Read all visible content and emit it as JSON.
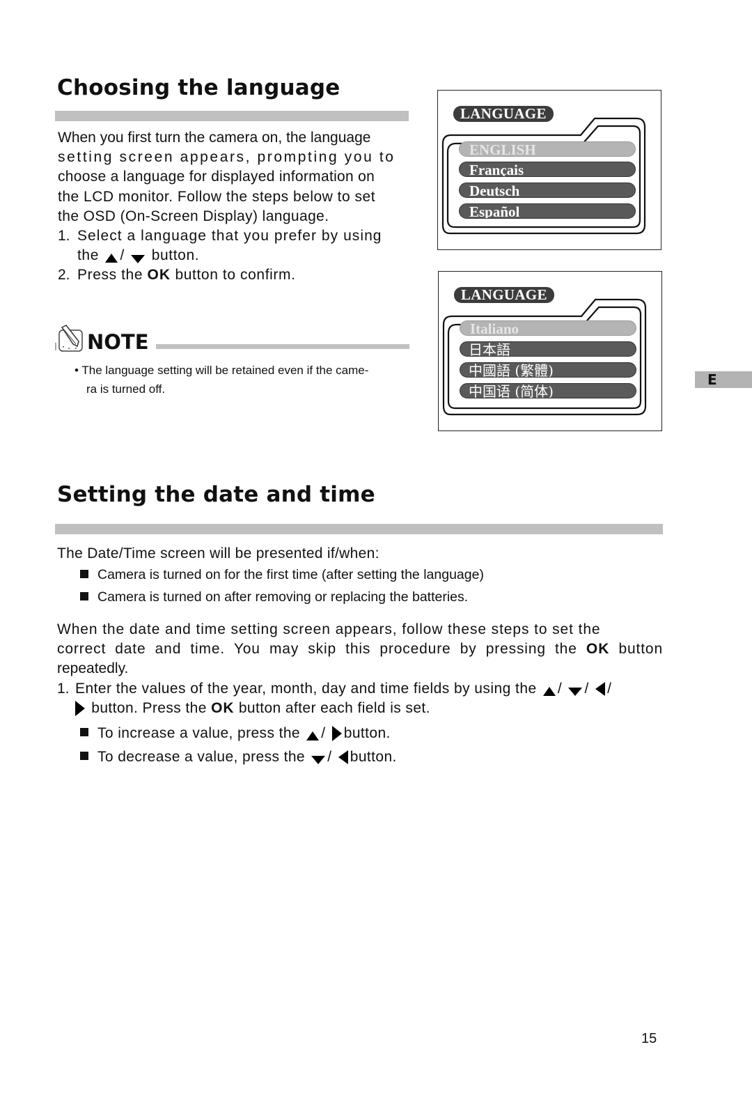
{
  "section1": {
    "title": "Choosing the language",
    "intro_lines": [
      "When you first turn the camera on, the language",
      "setting screen appears, prompting you to",
      "choose a language for displayed information on",
      "the LCD monitor. Follow the steps below to set",
      "the OSD (On-Screen Display) language."
    ],
    "steps": [
      {
        "num": "1.",
        "line1": "Select a language that you prefer by using",
        "line2_pre": "the",
        "sep": "/",
        "line2_post": "button."
      },
      {
        "num": "2.",
        "pre": "Press the",
        "ok": "OK",
        "post": "button to confirm."
      }
    ],
    "note": {
      "title": "NOTE",
      "bullet": "•",
      "line1": "The language setting will be retained even if the came-",
      "line2": "ra is turned off."
    }
  },
  "lcd_screens": [
    {
      "tab": "LANGUAGE",
      "items": [
        {
          "label": "ENGLISH",
          "selected": true
        },
        {
          "label": "Français",
          "selected": false
        },
        {
          "label": "Deutsch",
          "selected": false
        },
        {
          "label": "Español",
          "selected": false
        }
      ]
    },
    {
      "tab": "LANGUAGE",
      "items": [
        {
          "label": "Italiano",
          "selected": true
        },
        {
          "label": "日本語",
          "selected": false
        },
        {
          "label": "中國語 (繁體)",
          "selected": false
        },
        {
          "label": "中国语 (简体)",
          "selected": false
        }
      ]
    }
  ],
  "section2": {
    "title": "Setting the date and time",
    "lead": "The Date/Time screen will be presented if/when:",
    "conditions": [
      "Camera is turned on for the first time (after setting the language)",
      "Camera is turned on after removing or replacing the batteries."
    ],
    "para_line1": "When the date and time setting screen appears, follow these steps to set the",
    "para_line2_pre": "correct date and time. You may skip this procedure by pressing the",
    "para_line2_ok": "OK",
    "para_line2_post": "button",
    "para_line3": "repeatedly.",
    "step1": {
      "num": "1.",
      "line1": "Enter the values of the year, month, day and time fields by using the",
      "sep": "/",
      "line2_pre": "button. Press the",
      "ok": "OK",
      "line2_post": "button after each field is set."
    },
    "increase": {
      "pre": "To increase a value, press the",
      "sep": "/",
      "post": "button."
    },
    "decrease": {
      "pre": "To decrease a value, press the",
      "sep": "/",
      "post": "button."
    }
  },
  "side_tab": "E",
  "page_number": "15",
  "icons": {
    "up": "up-triangle-icon",
    "down": "down-triangle-icon",
    "left": "left-triangle-icon",
    "right": "right-triangle-icon",
    "note": "pencil-note-icon",
    "bullet": "square-bullet-icon"
  },
  "colors": {
    "rule": "#c0c0c0",
    "lcd_item": "#5a5a5a",
    "lcd_selected": "#b4b4b4",
    "lcd_tab": "#3c3c3c",
    "side_tab": "#b3b3b3"
  }
}
